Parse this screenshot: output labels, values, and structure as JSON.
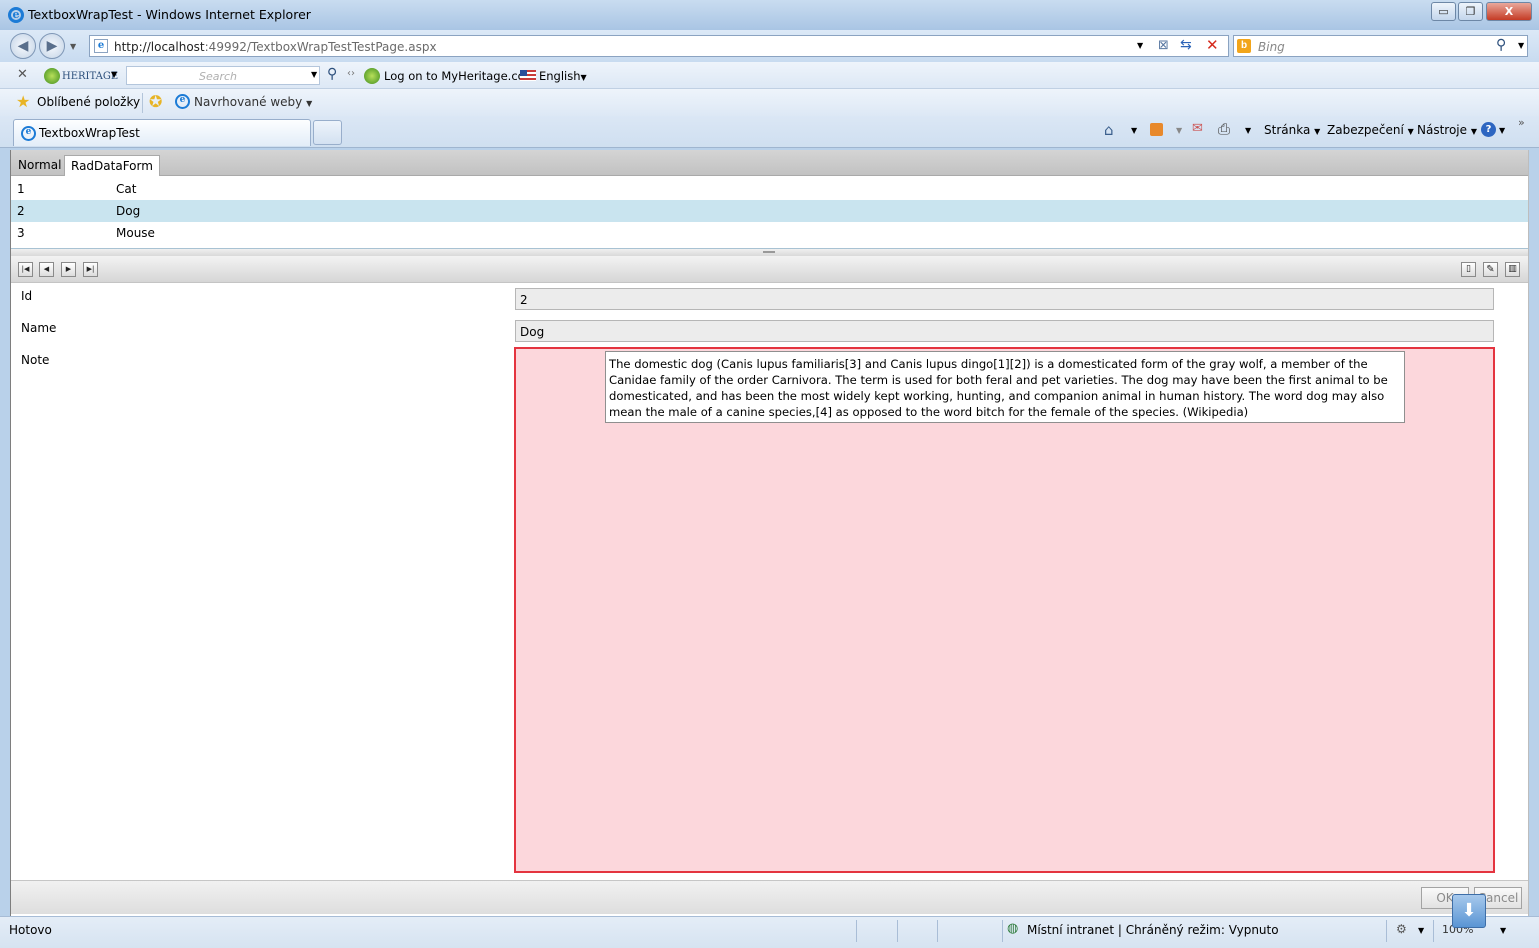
{
  "window": {
    "title": "TextboxWrapTest - Windows Internet Explorer",
    "minimize": "▭",
    "restore": "❐",
    "close": "X"
  },
  "address": {
    "url_host": "http://localhost",
    "url_rest": ":49992/TextboxWrapTestTestPage.aspx",
    "search_placeholder": "Bing"
  },
  "toolbar": {
    "brand": "HERITAGE",
    "search_placeholder": "Search",
    "login": "Log on to MyHeritage.com",
    "language": "English"
  },
  "favorites": {
    "favorites_label": "Oblíbené položky",
    "suggested_label": "Navrhované weby"
  },
  "tabs": {
    "active_tab": "TextboxWrapTest"
  },
  "commands": {
    "page": "Stránka",
    "security": "Zabezpečení",
    "tools": "Nástroje"
  },
  "app": {
    "tabs": [
      "Normal",
      "RadDataForm"
    ],
    "rows": [
      {
        "id": "1",
        "name": "Cat"
      },
      {
        "id": "2",
        "name": "Dog"
      },
      {
        "id": "3",
        "name": "Mouse"
      }
    ],
    "selected_row": 2,
    "form": {
      "id_label": "Id",
      "id_value": "2",
      "name_label": "Name",
      "name_value": "Dog",
      "note_label": "Note",
      "note_value": "The domestic dog (Canis lupus familiaris[3] and Canis lupus dingo[1][2]) is a domesticated form of the gray wolf, a member of the Canidae family of the order Carnivora. The term is used for both feral and pet varieties. The dog may have been the first animal to be domesticated, and has been the most widely kept working, hunting, and companion animal in human history. The word dog may also mean the male of a canine species,[4] as opposed to the word bitch for the female of the species. (Wikipedia)"
    },
    "ok_label": "OK",
    "cancel_label": "Cancel"
  },
  "status": {
    "left": "Hotovo",
    "zone": "Místní intranet | Chráněný režim: Vypnuto",
    "zoom": "100%"
  },
  "colors": {
    "selected_row": "#c9e4ef",
    "invalid_border": "#e4343f",
    "invalid_fill": "#fcd7dc"
  }
}
